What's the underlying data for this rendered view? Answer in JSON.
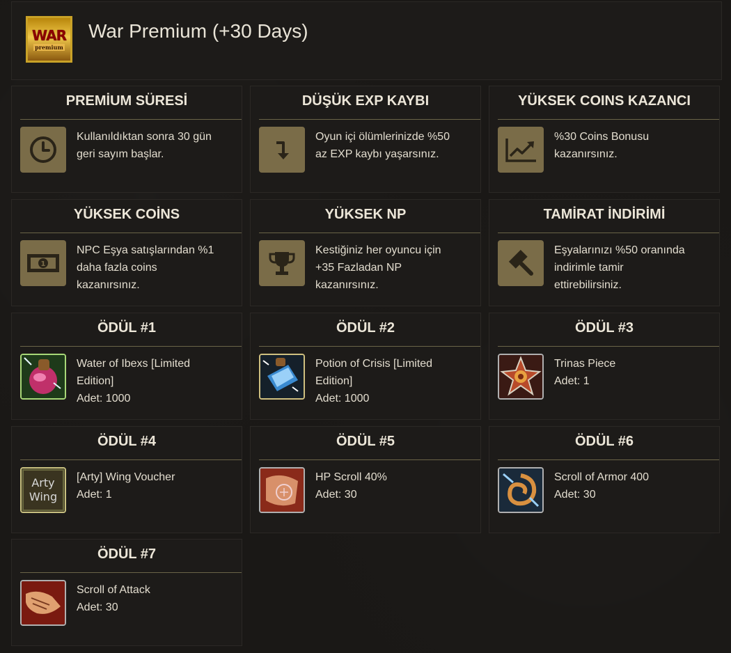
{
  "header": {
    "title": "War Premium (+30 Days)",
    "logo_text_main": "WAR",
    "logo_text_sub": "premium"
  },
  "features": [
    {
      "title": "PREMİUM SÜRESİ",
      "desc": "Kullanıldıktan sonra 30 gün\ngeri sayım başlar.",
      "icon": "clock-icon"
    },
    {
      "title": "DÜŞÜK EXP KAYBI",
      "desc": "Oyun içi ölümlerinizde %50\naz EXP kaybı yaşarsınız.",
      "icon": "arrow-down-icon"
    },
    {
      "title": "YÜKSEK COINS KAZANCI",
      "desc": "%30 Coins Bonusu\nkazanırsınız.",
      "icon": "chart-up-icon"
    },
    {
      "title": "YÜKSEK COİNS",
      "desc": "NPC Eşya satışlarından %1\ndaha fazla coins\nkazanırsınız.",
      "icon": "money-icon"
    },
    {
      "title": "YÜKSEK NP",
      "desc": "Kestiğiniz her oyuncu için\n+35 Fazladan NP\nkazanırsınız.",
      "icon": "trophy-icon"
    },
    {
      "title": "TAMİRAT İNDİRİMİ",
      "desc": "Eşyalarınızı %50 oranında\nindirimle tamir\nettirebilirsiniz.",
      "icon": "hammer-icon"
    }
  ],
  "rewards": [
    {
      "title": "ÖDÜL #1",
      "name": "Water of Ibexs [Limited\nEdition]",
      "qty": "Adet: 1000",
      "icon": "water-of-ibexs-icon"
    },
    {
      "title": "ÖDÜL #2",
      "name": "Potion of Crisis [Limited\nEdition]",
      "qty": "Adet: 1000",
      "icon": "potion-of-crisis-icon"
    },
    {
      "title": "ÖDÜL #3",
      "name": "Trinas Piece",
      "qty": "Adet: 1",
      "icon": "trinas-piece-icon"
    },
    {
      "title": "ÖDÜL #4",
      "name": "[Arty] Wing Voucher",
      "qty": "Adet: 1",
      "icon": "wing-voucher-icon",
      "icon_text_1": "Arty",
      "icon_text_2": "Wing"
    },
    {
      "title": "ÖDÜL #5",
      "name": "HP Scroll 40%",
      "qty": "Adet: 30",
      "icon": "hp-scroll-icon"
    },
    {
      "title": "ÖDÜL #6",
      "name": "Scroll of Armor 400",
      "qty": "Adet: 30",
      "icon": "armor-scroll-icon"
    },
    {
      "title": "ÖDÜL #7",
      "name": "Scroll of Attack",
      "qty": "Adet: 30",
      "icon": "attack-scroll-icon"
    }
  ],
  "colors": {
    "background": "#1a1816",
    "card": "#1d1b19",
    "feature_icon_bg": "#7a6c48",
    "divider": "#6b6548"
  }
}
